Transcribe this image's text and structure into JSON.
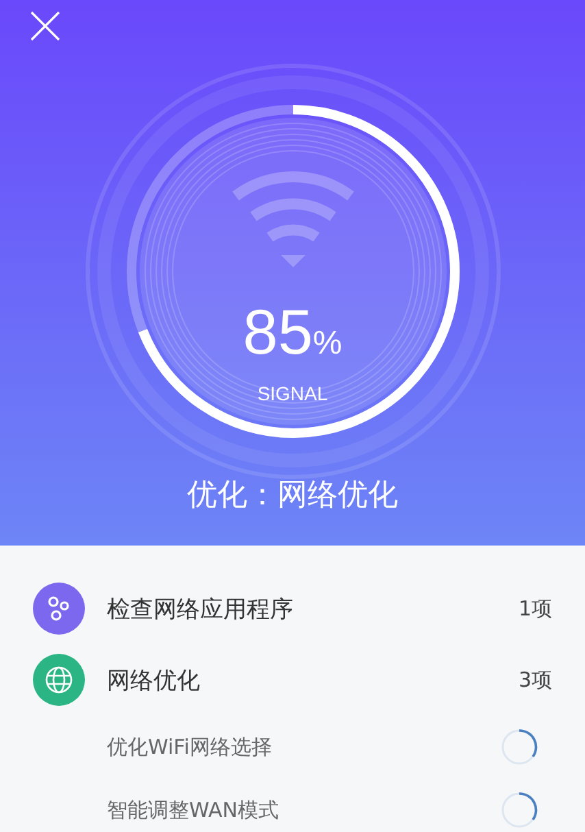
{
  "gauge": {
    "value": "85",
    "unit": "%",
    "label": "SIGNAL",
    "level": 0.69
  },
  "title": "优化：网络优化",
  "tasks": [
    {
      "kind": "group",
      "color": "#7b68ee",
      "label": "检查网络应用程序",
      "count": "1项"
    },
    {
      "kind": "group",
      "color": "#2bb584",
      "label": "网络优化",
      "count": "3项"
    },
    {
      "kind": "sub",
      "label": "优化WiFi网络选择"
    },
    {
      "kind": "sub",
      "label": "智能调整WAN模式"
    }
  ]
}
